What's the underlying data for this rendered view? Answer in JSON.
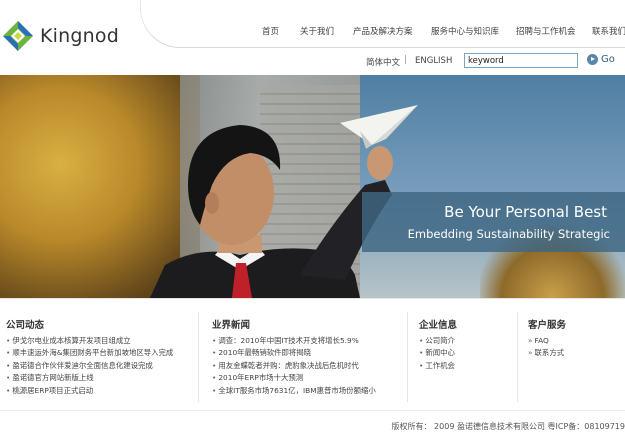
{
  "brand": {
    "name": "Kingnod",
    "colors": {
      "blue": "#2a6fb3",
      "green": "#6cb33f",
      "accent": "#3e6682"
    }
  },
  "nav": {
    "items": [
      "首页",
      "关于我们",
      "产品及解决方案",
      "服务中心与知识库",
      "招聘与工作机会",
      "联系我们"
    ]
  },
  "subbar": {
    "lang_cn": "简体中文",
    "separator": "|",
    "lang_en": "ENGLISH",
    "search_value": "keyword",
    "go_label": "Go"
  },
  "banner": {
    "headline": "Be Your Personal Best",
    "subline": "Embedding Sustainability Strategic"
  },
  "columns": {
    "company_news": {
      "title": "公司动态",
      "items": [
        "伊戈尔电业成本核算开发项目组成立",
        "顺丰速运外海&集团财务平台新加坡地区导入完成",
        "盈诺德合作伙伴爱迪尔全面信息化建设完成",
        "盈诺德官方网站新版上线",
        "桃源居ERP项目正式启动"
      ]
    },
    "industry_news": {
      "title": "业界新闻",
      "items": [
        "调查：2010年中国IT技术开支将增长5.9%",
        "2010年最畅销软件即将揭晓",
        "用友金蝶乾者并购：虎豹象决战后危机时代",
        "2010年ERP市场十大预测",
        "全球IT服务市场7631亿，IBM惠普市场份额缩小"
      ]
    },
    "company_info": {
      "title": "企业信息",
      "items": [
        "公司简介",
        "新闻中心",
        "工作机会"
      ]
    },
    "customer_service": {
      "title": "客户服务",
      "items": [
        "FAQ",
        "联系方式"
      ]
    }
  },
  "footer": {
    "copyright": "版权所有： 2009 盈诺德信息技术有限公司   粤ICP备：08109719"
  }
}
